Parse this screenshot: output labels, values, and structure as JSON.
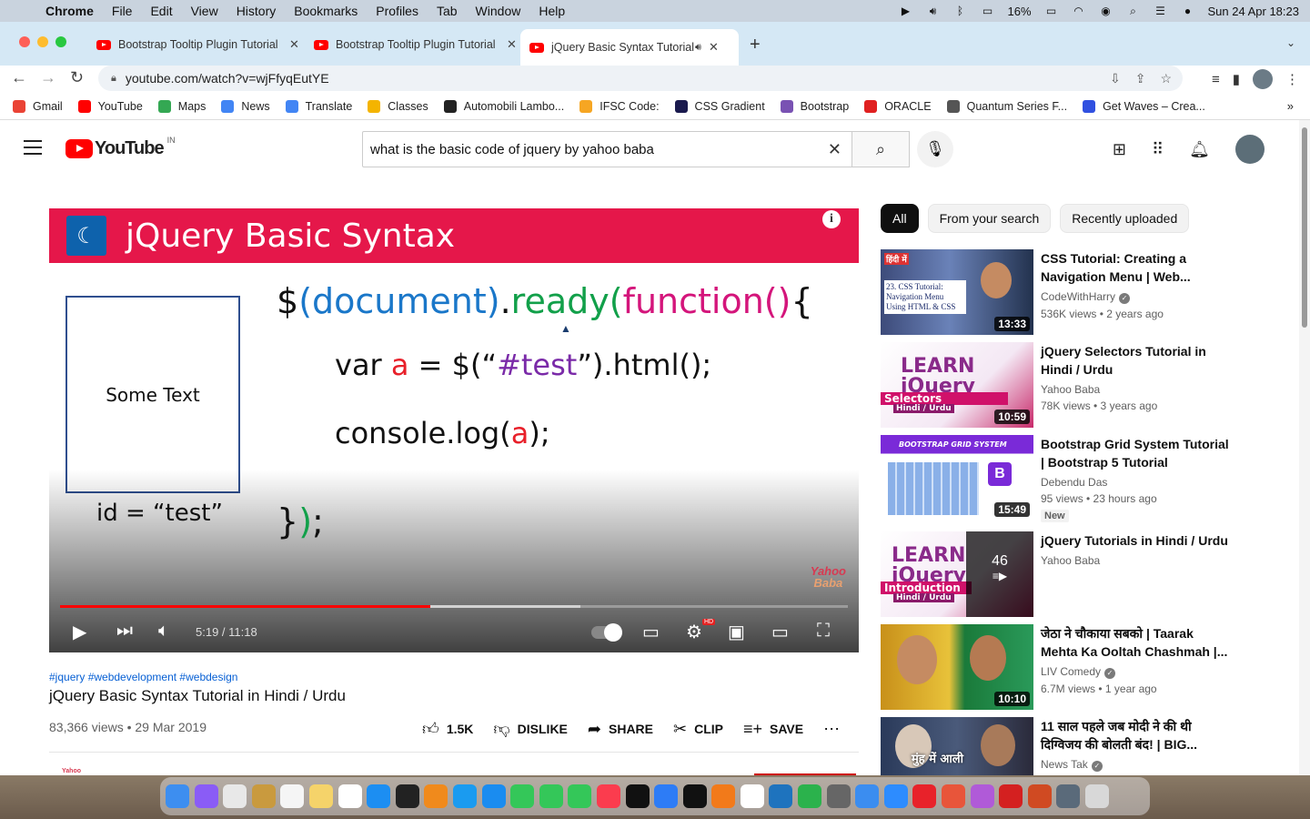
{
  "menubar": {
    "app": "Chrome",
    "items": [
      "File",
      "Edit",
      "View",
      "History",
      "Bookmarks",
      "Profiles",
      "Tab",
      "Window",
      "Help"
    ],
    "battery": "16%",
    "datetime": "Sun 24 Apr  18:23"
  },
  "tabs": [
    {
      "title": "Bootstrap Tooltip Plugin Tutorial",
      "close": "✕"
    },
    {
      "title": "Bootstrap Tooltip Plugin Tutorial",
      "close": "✕"
    },
    {
      "title": "jQuery Basic Syntax Tutorial",
      "close": "✕"
    }
  ],
  "toolbar": {
    "url": "youtube.com/watch?v=wjFfyqEutYE"
  },
  "bookmarks": [
    {
      "label": "Gmail",
      "color": "#ea4335"
    },
    {
      "label": "YouTube",
      "color": "#ff0000"
    },
    {
      "label": "Maps",
      "color": "#34a853"
    },
    {
      "label": "News",
      "color": "#4285f4"
    },
    {
      "label": "Translate",
      "color": "#4285f4"
    },
    {
      "label": "Classes",
      "color": "#f4b400"
    },
    {
      "label": "Automobili Lambo...",
      "color": "#222222"
    },
    {
      "label": "IFSC Code:",
      "color": "#f6a623"
    },
    {
      "label": "CSS Gradient",
      "color": "#1a1a4e"
    },
    {
      "label": "Bootstrap",
      "color": "#7952b3"
    },
    {
      "label": "ORACLE",
      "color": "#e02020"
    },
    {
      "label": "Quantum Series F...",
      "color": "#555555"
    },
    {
      "label": "Get Waves – Crea...",
      "color": "#3050e0"
    }
  ],
  "youtube": {
    "logo_text": "YouTube",
    "country": "IN",
    "search_value": "what is the basic code of jquery by yahoo baba"
  },
  "slide": {
    "title": "jQuery Basic Syntax",
    "box_text": "Some Text",
    "box_id": "id = “test”",
    "code1": {
      "a": "$",
      "b": "(",
      "c": "document",
      "d": ")",
      "e": ".",
      "f": "ready",
      "g": "(",
      "h": "function",
      "i": "()",
      "j": "{"
    },
    "code2": {
      "a": "var ",
      "b": "a",
      "c": " = $(“",
      "d": "#test",
      "e": "”).html();"
    },
    "code3": {
      "a": "console.log(",
      "b": "a",
      "c": ");"
    },
    "code4": {
      "a": "}",
      "b": ")",
      "c": ";"
    },
    "watermark_1": "Yahoo",
    "watermark_2": "Baba"
  },
  "player": {
    "time": "5:19 / 11:18",
    "progress_fraction": 0.47,
    "buffered_fraction": 0.66,
    "hd_badge": "HD"
  },
  "video": {
    "tags": "#jquery #webdevelopment #webdesign",
    "title": "jQuery Basic Syntax Tutorial in Hindi / Urdu",
    "meta": "83,366 views • 29 Mar 2019",
    "likes": "1.5K",
    "dislike": "DISLIKE",
    "share": "SHARE",
    "clip": "CLIP",
    "save": "SAVE",
    "channel_logo": "Yahoo"
  },
  "chips": [
    "All",
    "From your search",
    "Recently uploaded"
  ],
  "recommendations": [
    {
      "title": "CSS Tutorial: Creating a Navigation Menu | Web...",
      "channel": "CodeWithHarry",
      "verified": true,
      "views": "536K views • 2 years ago",
      "duration": "13:33",
      "thumb_text_1": "हिंदी में",
      "thumb_text_2": "23. CSS Tutorial: Navigation Menu Using HTML & CSS"
    },
    {
      "title": "jQuery Selectors Tutorial in Hindi / Urdu",
      "channel": "Yahoo Baba",
      "verified": false,
      "views": "78K views • 3 years ago",
      "duration": "10:59",
      "thumb_text_1": "LEARN jQuery",
      "thumb_text_2": "Selectors",
      "thumb_text_3": "Hindi / Urdu"
    },
    {
      "title": "Bootstrap Grid System Tutorial | Bootstrap 5 Tutorial",
      "channel": "Debendu Das",
      "verified": false,
      "views": "95 views • 23 hours ago",
      "duration": "15:49",
      "badge": "New",
      "thumb_text_1": "BOOTSTRAP GRID SYSTEM"
    },
    {
      "title": "jQuery Tutorials in Hindi / Urdu",
      "channel": "Yahoo Baba",
      "verified": false,
      "views": "",
      "playlist_count": "46",
      "thumb_text_1": "LEARN jQuery",
      "thumb_text_2": "Introduction",
      "thumb_text_3": "Hindi / Urdu"
    },
    {
      "title": "जेठा ने चौकाया सबको | Taarak Mehta Ka Ooltah Chashmah |...",
      "channel": "LIV Comedy",
      "verified": true,
      "views": "6.7M views • 1 year ago",
      "duration": "10:10"
    },
    {
      "title": "11 साल पहले जब मोदी ने की थी दिग्विजय की बोलती बंद! | BIG...",
      "channel": "News Tak",
      "verified": true,
      "views": "",
      "thumb_text_1": "मुंह में आली"
    }
  ],
  "dock_colors": [
    "#3d8ef0",
    "#8a5cf6",
    "#e8e8e8",
    "#c99a3e",
    "#f5f5f5",
    "#f5d36a",
    "#ffffff",
    "#1c8ef2",
    "#222222",
    "#f08a1c",
    "#1a9bf0",
    "#1a8cf0",
    "#34c759",
    "#34c759",
    "#34c759",
    "#fb3c4e",
    "#111111",
    "#2d7cf6",
    "#111111",
    "#f27a1a",
    "#ffffff",
    "#1e73be",
    "#2bb24c",
    "#666666",
    "#3b8df0",
    "#2d8cff",
    "#e8222a",
    "#e8553a",
    "#b05ad8",
    "#d42020",
    "#d04a22",
    "#5a6a7a",
    "#d8d8d8"
  ]
}
